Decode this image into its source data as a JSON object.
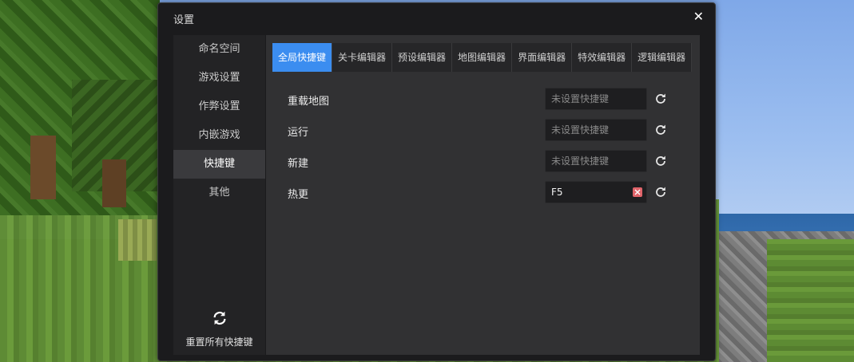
{
  "dialog": {
    "title": "设置",
    "close_label": "✕"
  },
  "sidebar": {
    "items": [
      {
        "label": "命名空间"
      },
      {
        "label": "游戏设置"
      },
      {
        "label": "作弊设置"
      },
      {
        "label": "内嵌游戏"
      },
      {
        "label": "快捷键",
        "active": true
      },
      {
        "label": "其他"
      }
    ],
    "reset_all_label": "重置所有快捷键"
  },
  "tabs": [
    {
      "label": "全局快捷键",
      "active": true
    },
    {
      "label": "关卡编辑器"
    },
    {
      "label": "预设编辑器"
    },
    {
      "label": "地图编辑器"
    },
    {
      "label": "界面编辑器"
    },
    {
      "label": "特效编辑器"
    },
    {
      "label": "逻辑编辑器"
    }
  ],
  "shortcuts": [
    {
      "label": "重载地图",
      "value": "",
      "placeholder": "未设置快捷键"
    },
    {
      "label": "运行",
      "value": "",
      "placeholder": "未设置快捷键"
    },
    {
      "label": "新建",
      "value": "",
      "placeholder": "未设置快捷键"
    },
    {
      "label": "热更",
      "value": "F5",
      "placeholder": "未设置快捷键"
    }
  ],
  "colors": {
    "accent": "#3b8df0",
    "clear_button": "#e0646a"
  }
}
